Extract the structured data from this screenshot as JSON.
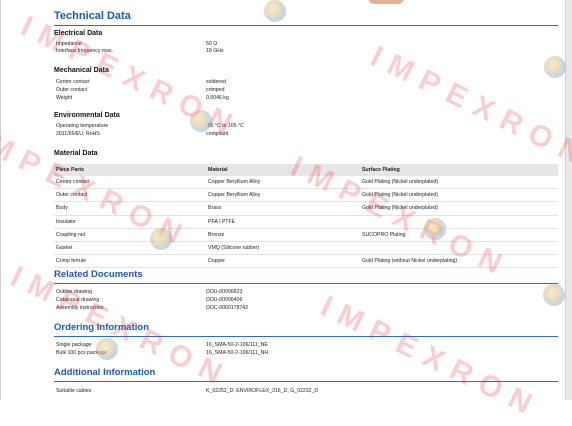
{
  "title": "Technical Data",
  "sections": {
    "electrical": {
      "heading": "Electrical Data",
      "rows": [
        {
          "label": "Impedance",
          "value": "50 Ω"
        },
        {
          "label": "Interface frequency max.",
          "value": "18 GHz"
        }
      ]
    },
    "mechanical": {
      "heading": "Mechanical Data",
      "rows": [
        {
          "label": "Centre contact",
          "value": "soldered"
        },
        {
          "label": "Outer contact",
          "value": "crimped"
        },
        {
          "label": "Weight",
          "value": "0.0046 kg"
        }
      ]
    },
    "environmental": {
      "heading": "Environmental Data",
      "rows": [
        {
          "label": "Operating temperature",
          "value": "-65 °C to 165 °C"
        },
        {
          "label": "2011/65/EU, RoHS",
          "value": "compliant"
        }
      ]
    },
    "material": {
      "heading": "Material Data",
      "columns": [
        "Piece Parts",
        "Material",
        "Surface Plating"
      ],
      "rows": [
        [
          "Centre contact",
          "Copper Beryllium Alloy",
          "Gold Plating (Nickel underplated)"
        ],
        [
          "Outer contact",
          "Copper Beryllium Alloy",
          "Gold Plating (Nickel underplated)"
        ],
        [
          "Body",
          "Brass",
          "Gold Plating (Nickel underplated)"
        ],
        [
          "Insulator",
          "PFA / PTFE",
          ""
        ],
        [
          "Coupling nut",
          "Bronze",
          "SUCOPRO Plating"
        ],
        [
          "Gasket",
          "VMQ (Silicone rubber)",
          ""
        ],
        [
          "Crimp ferrule",
          "Copper",
          "Gold Plating (without Nickel underplating)"
        ]
      ]
    },
    "related": {
      "heading": "Related Documents",
      "rows": [
        {
          "label": "Outline drawing",
          "value": "DOU-00006823"
        },
        {
          "label": "Catalogue drawing",
          "value": "DOU-00006406"
        },
        {
          "label": "Assembly instruction",
          "value": "DOC-0000178742"
        }
      ]
    },
    "ordering": {
      "heading": "Ordering Information",
      "rows": [
        {
          "label": "Single package",
          "value": "16_SMA-50-2-106/111_NE"
        },
        {
          "label": "Bulk 100 pcs package",
          "value": "16_SMA-50-2-106/111_NH"
        }
      ]
    },
    "additional": {
      "heading": "Additional Information",
      "rows": [
        {
          "label": "Suitable cables",
          "value": "K_02252_D, ENVIROFLEX_316_D, G_02232_D"
        }
      ]
    }
  },
  "watermark": {
    "text": "IMPEXRON",
    "color": "#e3252f"
  },
  "colors": {
    "heading": "#1d5aa8",
    "rule": "#2d6cc0",
    "table_header_bg": "#e6e6e6"
  }
}
